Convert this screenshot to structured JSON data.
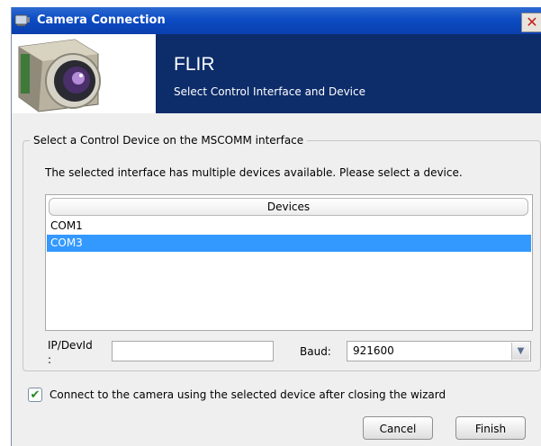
{
  "window": {
    "title": "Camera Connection",
    "close_glyph": "✕"
  },
  "banner": {
    "brand": "FLIR",
    "subtitle": "Select Control Interface and Device"
  },
  "group": {
    "legend": "Select a Control Device on the MSCOMM interface",
    "instruction": "The selected interface has multiple devices available. Please select a device."
  },
  "devices": {
    "header": "Devices",
    "items": [
      {
        "label": "COM1",
        "selected": false
      },
      {
        "label": "COM3",
        "selected": true
      }
    ]
  },
  "ipdev": {
    "label_line1": "IP/DevId",
    "label_line2": ":",
    "value": ""
  },
  "baud": {
    "label": "Baud:",
    "value": "921600"
  },
  "checkbox": {
    "label": "Connect to the camera using the selected device after closing the wizard",
    "checked": true,
    "glyph": "✔"
  },
  "buttons": {
    "cancel": "Cancel",
    "finish": "Finish"
  },
  "colors": {
    "titlebar": "#0c4cc4",
    "banner": "#0d2c6a",
    "selection": "#3399ff"
  }
}
